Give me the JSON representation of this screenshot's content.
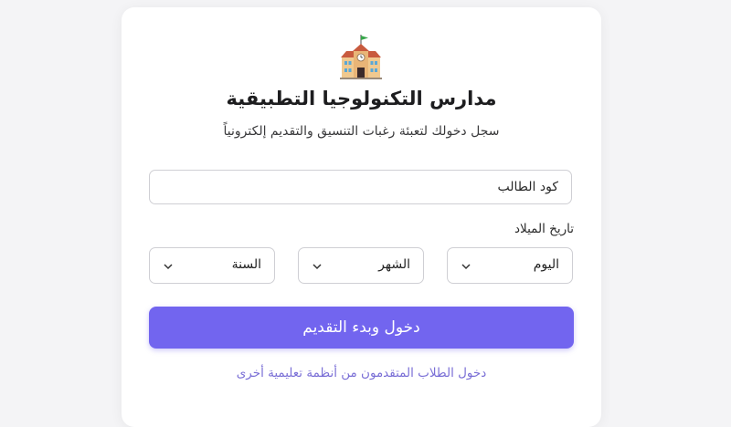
{
  "header": {
    "logo_icon": "school-building-icon",
    "title": "مدارس التكنولوجيا التطبيقية",
    "subtitle": "سجل دخولك لتعبئة رغبات التنسيق والتقديم إلكترونياً"
  },
  "form": {
    "code_placeholder": "كود الطالب",
    "dob_label": "تاريخ الميلاد",
    "day": "اليوم",
    "month": "الشهر",
    "year": "السنة",
    "submit_label": "دخول وبدء التقديم",
    "other_systems_link": "دخول الطلاب المتقدمون من أنظمة تعليمية أخرى"
  },
  "colors": {
    "accent": "#7265ef",
    "link": "#7a6fd6",
    "background": "#f4f4f6"
  }
}
